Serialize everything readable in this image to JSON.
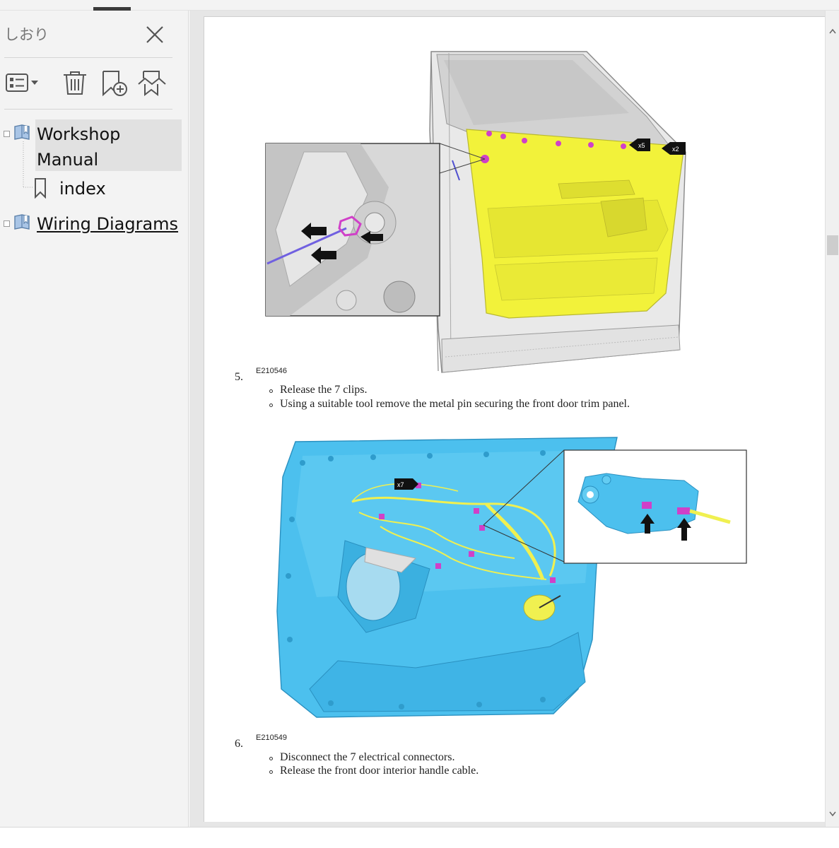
{
  "sidebar": {
    "title": "しおり",
    "toolbar": {
      "options_icon": "list-options-icon",
      "delete_icon": "trash-icon",
      "add_icon": "add-bookmark-icon",
      "find_icon": "find-bookmark-icon"
    },
    "tree": [
      {
        "label_line1": "Workshop",
        "label_line2": "Manual",
        "icon": "bookmark-book-icon",
        "selected": true,
        "children": [
          {
            "label": "index",
            "icon": "bookmark-icon"
          }
        ]
      },
      {
        "label": "Wiring Diagrams",
        "icon": "bookmark-book-icon",
        "link": true
      }
    ]
  },
  "document": {
    "steps": [
      {
        "number": "5.",
        "figure_id": "E210546",
        "bullets": [
          "Release the 7 clips.",
          "Using a suitable tool remove the metal pin securing the front door trim panel."
        ]
      },
      {
        "number": "6.",
        "figure_id": "E210549",
        "bullets": [
          "Disconnect the 7 electrical connectors.",
          "Release the front door interior handle cable."
        ]
      }
    ],
    "figure1_callouts": [
      "x5",
      "x2"
    ],
    "figure2_callouts": [
      "x7"
    ]
  },
  "colors": {
    "trim_yellow": "#f2f23a",
    "panel_blue": "#4cc0ee",
    "connector_magenta": "#d040c8",
    "harness_yellow": "#f0f050"
  }
}
